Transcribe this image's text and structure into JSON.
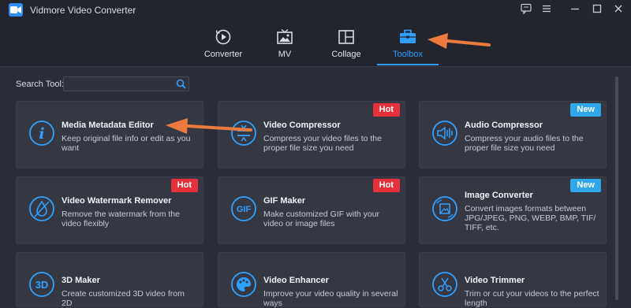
{
  "app": {
    "title": "Vidmore Video Converter"
  },
  "colors": {
    "accent": "#2fa0ff",
    "hot": "#e8303a",
    "new": "#2fa7e8",
    "annotation_arrow": "#ec7a3f"
  },
  "nav": {
    "tabs": [
      {
        "label": "Converter",
        "icon": "converter-icon"
      },
      {
        "label": "MV",
        "icon": "mv-icon"
      },
      {
        "label": "Collage",
        "icon": "collage-icon"
      },
      {
        "label": "Toolbox",
        "icon": "toolbox-icon",
        "active": true
      }
    ]
  },
  "search": {
    "label": "Search Tool:",
    "value": "",
    "placeholder": ""
  },
  "tools": [
    {
      "title": "Media Metadata Editor",
      "desc": "Keep original file info or edit as you want",
      "badge": "",
      "icon": "info-icon"
    },
    {
      "title": "Video Compressor",
      "desc": "Compress your video files to the proper file size you need",
      "badge": "Hot",
      "icon": "compress-icon"
    },
    {
      "title": "Audio Compressor",
      "desc": "Compress your audio files to the proper file size you need",
      "badge": "New",
      "icon": "audio-compress-icon"
    },
    {
      "title": "Video Watermark Remover",
      "desc": "Remove the watermark from the video flexibly",
      "badge": "Hot",
      "icon": "watermark-remove-icon"
    },
    {
      "title": "GIF Maker",
      "desc": "Make customized GIF with your video or image files",
      "badge": "Hot",
      "icon": "gif-icon"
    },
    {
      "title": "Image Converter",
      "desc": "Convert images formats between JPG/JPEG, PNG, WEBP, BMP, TIF/ TIFF, etc.",
      "badge": "New",
      "icon": "image-convert-icon"
    },
    {
      "title": "3D Maker",
      "desc": "Create customized 3D video from 2D",
      "badge": "",
      "icon": "3d-icon"
    },
    {
      "title": "Video Enhancer",
      "desc": "Improve your video quality in several ways",
      "badge": "",
      "icon": "palette-icon"
    },
    {
      "title": "Video Trimmer",
      "desc": "Trim or cut your videos to the perfect length",
      "badge": "",
      "icon": "scissors-icon"
    }
  ]
}
